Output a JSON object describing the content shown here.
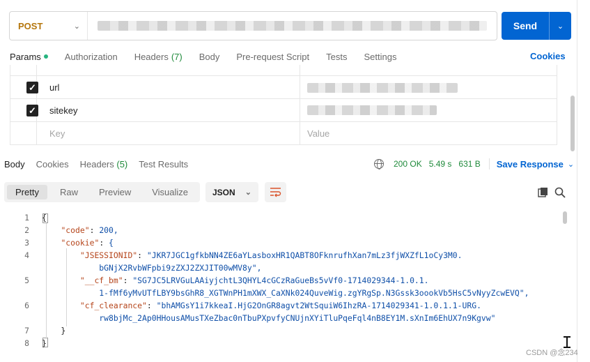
{
  "request": {
    "method": "POST",
    "send_label": "Send"
  },
  "request_tabs": [
    {
      "label": "Params",
      "active": true
    },
    {
      "label": "Authorization"
    },
    {
      "label": "Headers",
      "count": "(7)"
    },
    {
      "label": "Body"
    },
    {
      "label": "Pre-request Script"
    },
    {
      "label": "Tests"
    },
    {
      "label": "Settings"
    }
  ],
  "cookies_link": "Cookies",
  "params": {
    "rows": [
      {
        "key": "url",
        "checked": true
      },
      {
        "key": "sitekey",
        "checked": true
      }
    ],
    "key_placeholder": "Key",
    "value_placeholder": "Value"
  },
  "response_tabs": [
    {
      "label": "Body",
      "active": true
    },
    {
      "label": "Cookies"
    },
    {
      "label": "Headers",
      "count": "(5)"
    },
    {
      "label": "Test Results"
    }
  ],
  "status": {
    "code": "200 OK",
    "time": "5.49 s",
    "size": "631 B",
    "save_response": "Save Response"
  },
  "format_tabs": [
    "Pretty",
    "Raw",
    "Preview",
    "Visualize"
  ],
  "format_selected": "JSON",
  "code_lines": [
    {
      "n": "1",
      "text": "{"
    },
    {
      "n": "2",
      "text": "    \"code\": 200,"
    },
    {
      "n": "3",
      "text": "    \"cookie\": {"
    },
    {
      "n": "4",
      "text": "        \"JSESSIONID\": \"JKR7JGC1gfkbNN4ZE6aYLasboxHR1QABT8OFknrufhXan7mLz3fjWXZfL1oCy3M0."
    },
    {
      "n": "",
      "text": "            bGNjX2RvbWFpbi9zZXJ2ZXJIT00wMV8y\","
    },
    {
      "n": "5",
      "text": "        \"__cf_bm\": \"SG7JC5LRVGuLAAiyjchtL3QHYL4cGCzRaGueBs5vVf0-1714029344-1.0.1."
    },
    {
      "n": "",
      "text": "            1-fMf6yMvUTfLBY9bsGhR8_XGTWnPH1mXWX_CaXNk024QuveWig.zgYRgSp.N3Gssk3oookVb5HsC5vNyyZcwEVQ\","
    },
    {
      "n": "6",
      "text": "        \"cf_clearance\": \"bhAMGsY1i7kkeaI.HjG2OnGR8agvt2WtSquiW6IhzRA-1714029341-1.0.1.1-URG."
    },
    {
      "n": "",
      "text": "            rw8bjMc_2Ap0HHousAMusTXeZbac0nTbuPXpvfyCNUjnXYiTluPqeFql4nB8EY1M.sXnIm6EhUX7n9Kgvw\""
    },
    {
      "n": "7",
      "text": "    }"
    },
    {
      "n": "8",
      "text": "}"
    }
  ],
  "watermark": "CSDN @念234"
}
